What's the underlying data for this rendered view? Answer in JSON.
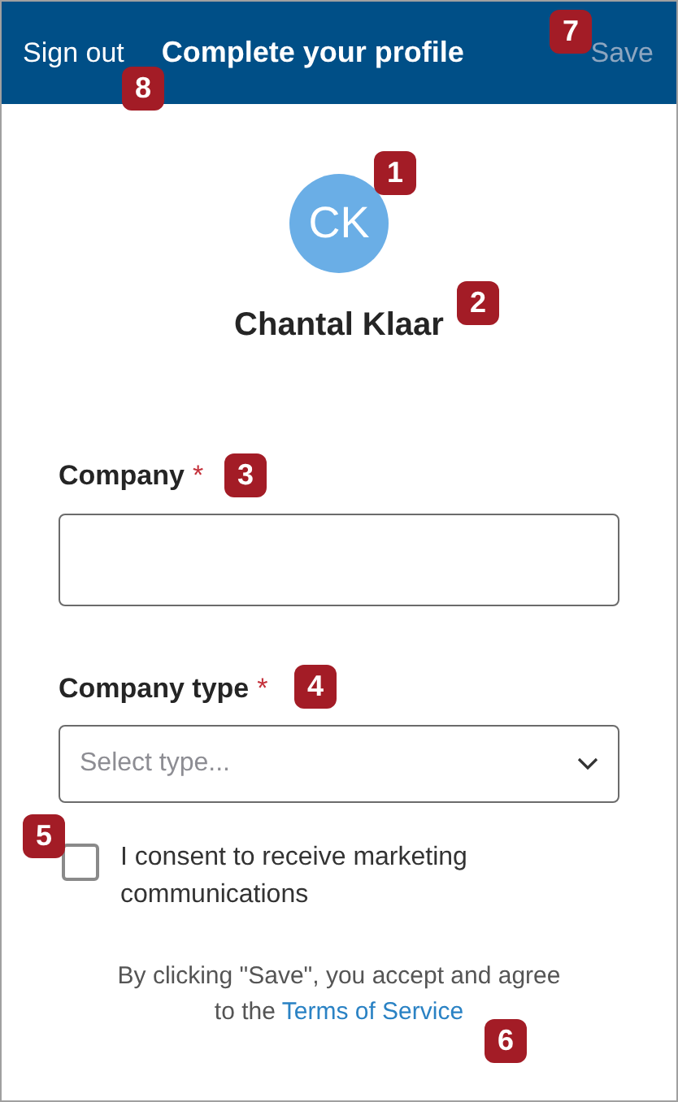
{
  "header": {
    "sign_out": "Sign out",
    "title": "Complete your profile",
    "save": {
      "label": "Save",
      "disabled": true
    }
  },
  "profile": {
    "initials": "CK",
    "name": "Chantal Klaar"
  },
  "fields": [
    {
      "kind": "text",
      "label": "Company",
      "required": true,
      "required_mark": "*"
    },
    {
      "kind": "select",
      "label": "Company type",
      "required": true,
      "required_mark": "*",
      "placeholder": "Select type..."
    }
  ],
  "consent": {
    "label": "I consent to receive marketing communications",
    "checked": false
  },
  "footer": {
    "text": "By clicking \"Save\", you accept and agree to the",
    "link": "Terms of Service"
  },
  "callouts": [
    "1",
    "2",
    "3",
    "4",
    "5",
    "6",
    "7",
    "8"
  ]
}
